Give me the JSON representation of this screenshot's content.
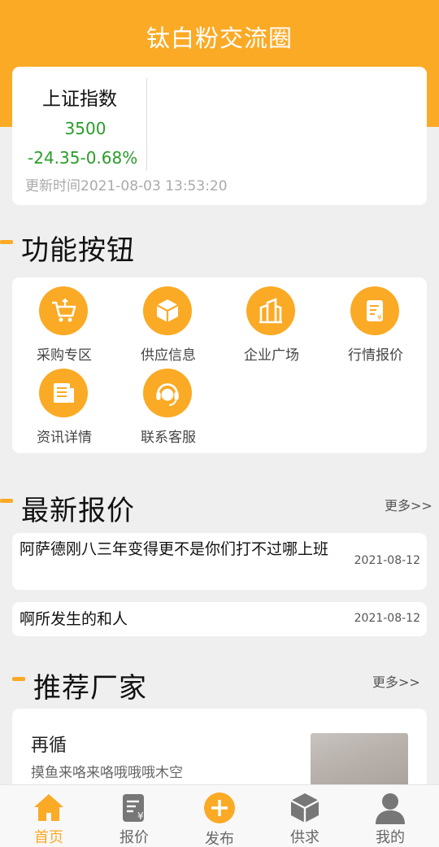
{
  "header": {
    "title": "钛白粉交流圈"
  },
  "index": {
    "name": "上证指数",
    "value": "3500",
    "change": "-24.35-0.68%",
    "update_time": "更新时间2021-08-03 13:53:20"
  },
  "functions": {
    "title": "功能按钮",
    "items": [
      {
        "label": "采购专区",
        "icon": "shopping-cart-icon"
      },
      {
        "label": "供应信息",
        "icon": "box-icon"
      },
      {
        "label": "企业广场",
        "icon": "building-icon"
      },
      {
        "label": "行情报价",
        "icon": "price-document-icon"
      },
      {
        "label": "资讯详情",
        "icon": "news-icon"
      },
      {
        "label": "联系客服",
        "icon": "customer-service-icon"
      }
    ]
  },
  "quotes": {
    "title": "最新报价",
    "more": "更多>>",
    "items": [
      {
        "title": "阿萨德刚八三年变得更不是你们打不过哪上班",
        "date": "2021-08-12"
      },
      {
        "title": "啊所发生的和人",
        "date": "2021-08-12"
      }
    ]
  },
  "factories": {
    "title": "推荐厂家",
    "more": "更多>>",
    "items": [
      {
        "name": "再循",
        "desc": "摸鱼来咯来咯哦哦哦木空"
      }
    ]
  },
  "tabbar": {
    "items": [
      {
        "label": "首页",
        "icon": "home-icon",
        "active": true
      },
      {
        "label": "报价",
        "icon": "price-document-icon",
        "active": false
      },
      {
        "label": "发布",
        "icon": "add-circle-icon",
        "active": false
      },
      {
        "label": "供求",
        "icon": "box-icon",
        "active": false
      },
      {
        "label": "我的",
        "icon": "user-icon",
        "active": false
      }
    ]
  },
  "colors": {
    "accent": "#fbaa25",
    "rise_fall": "#2a9c2a"
  }
}
